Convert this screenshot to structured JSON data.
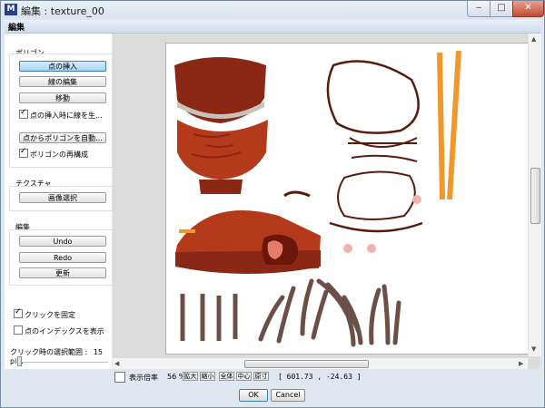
{
  "window": {
    "title": "編集 : texture_00",
    "icon_letter": "M",
    "min_label": "‒",
    "max_label": "□",
    "close_label": "✕"
  },
  "menubar": {
    "label": "編集"
  },
  "polygon_group": {
    "label": "ポリゴン",
    "insert_point": "点の挿入",
    "edit_line": "線の編集",
    "move": "移動",
    "gen_line_on_insert": "点の挿入時に線を生...",
    "auto_polygon": "点からポリゴンを自動...",
    "rebuild_polygon": "ポリゴンの再構成"
  },
  "texture_group": {
    "label": "テクスチャ",
    "select_image": "画像選択"
  },
  "edit_group": {
    "label": "編集",
    "undo": "Undo",
    "redo": "Redo",
    "update": "更新"
  },
  "options": {
    "fix_click": "クリックを固定",
    "show_index": "点のインデックスを表示",
    "range_label": "クリック時の選択範囲 :",
    "range_value": "15 pi..."
  },
  "status": {
    "zoom_label": "表示倍率",
    "zoom_value": "56 %",
    "zoom_in": "拡大",
    "zoom_out": "縮小",
    "all": "全体",
    "center": "中心",
    "original": "原寸",
    "coords": "[ 601.73 , -24.63 ]"
  },
  "dialog": {
    "ok": "OK",
    "cancel": "Cancel"
  },
  "colors": {
    "accent_select": "#a9d4f5",
    "bowl": "#b53a1c",
    "bowl_dark": "#6a1609",
    "chopstick": "#f1982d",
    "sticks": "#6c5048"
  },
  "icons": {
    "check": "✓",
    "left_arrow": "◀",
    "right_arrow": "▶",
    "up_arrow": "▲",
    "down_arrow": "▼"
  }
}
